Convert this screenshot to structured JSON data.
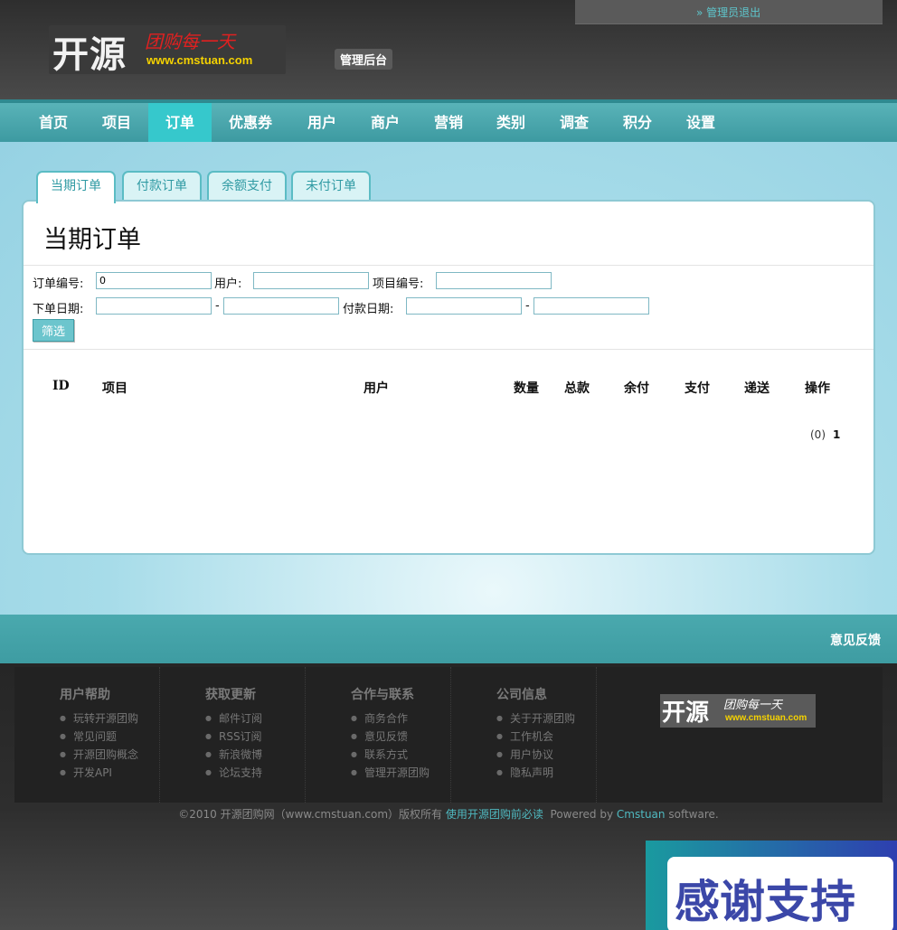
{
  "header": {
    "logout": "» 管理员退出",
    "logo_main": "开源",
    "logo_script": "团购每一天",
    "logo_url": "www.cmstuan.com",
    "admin_label": "管理后台"
  },
  "nav": [
    "首页",
    "项目",
    "订单",
    "优惠券",
    "用户",
    "商户",
    "营销",
    "类别",
    "调查",
    "积分",
    "设置"
  ],
  "nav_active": "订单",
  "tabs": [
    "当期订单",
    "付款订单",
    "余额支付",
    "未付订单"
  ],
  "panel": {
    "title": "当期订单",
    "filters": {
      "order_no_label": "订单编号:",
      "order_no_value": "0",
      "user_label": "用户:",
      "project_no_label": "项目编号:",
      "order_date_label": "下单日期:",
      "pay_date_label": "付款日期:",
      "range_sep": "-",
      "filter_button": "筛选"
    },
    "columns": [
      "ID",
      "项目",
      "用户",
      "数量",
      "总款",
      "余付",
      "支付",
      "递送",
      "操作"
    ],
    "pager_count": "(0)",
    "pager_page": "1"
  },
  "feedback": "意见反馈",
  "footer": {
    "columns": [
      {
        "title": "用户帮助",
        "items": [
          "玩转开源团购",
          "常见问题",
          "开源团购概念",
          "开发API"
        ]
      },
      {
        "title": "获取更新",
        "items": [
          "邮件订阅",
          "RSS订阅",
          "新浪微博",
          "论坛支持"
        ]
      },
      {
        "title": "合作与联系",
        "items": [
          "商务合作",
          "意见反馈",
          "联系方式",
          "管理开源团购"
        ]
      },
      {
        "title": "公司信息",
        "items": [
          "关于开源团购",
          "工作机会",
          "用户协议",
          "隐私声明"
        ]
      }
    ],
    "logo_main": "开源",
    "logo_script": "团购每一天",
    "logo_url": "www.cmstuan.com",
    "copyright_pre": "©2010 开源团购网（www.cmstuan.com）版权所有",
    "copyright_link": "使用开源团购前必读",
    "powered_pre": "Powered by",
    "powered_link": "Cmstuan",
    "powered_post": "software."
  },
  "thanks": "感谢支持"
}
